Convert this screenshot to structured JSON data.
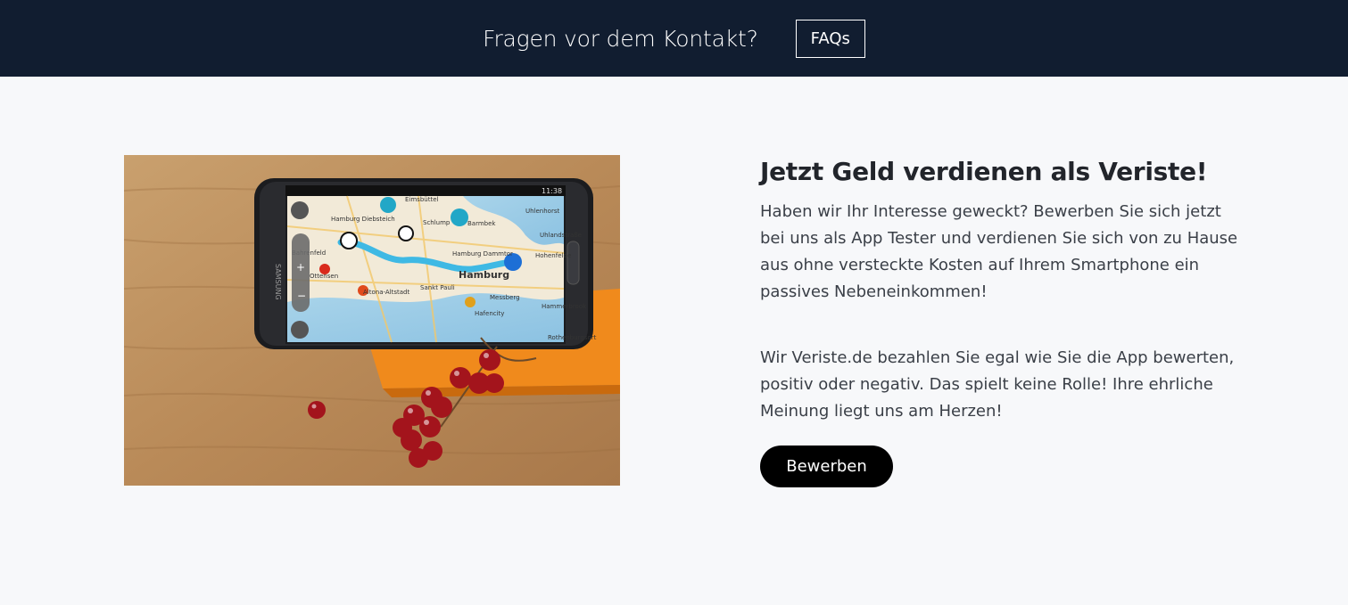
{
  "header": {
    "question": "Fragen vor dem Kontakt?",
    "faq_label": "FAQs"
  },
  "promo": {
    "heading": "Jetzt Geld verdienen als Veriste!",
    "paragraph_1": "Haben wir Ihr Interesse geweckt? Bewerben Sie sich jetzt bei uns als App Tester und verdienen Sie sich von zu Hause aus ohne versteckte Kosten auf Ihrem Smartphone ein passives Nebeneinkommen!",
    "paragraph_2": "Wir Veriste.de bezahlen Sie egal wie Sie die App bewerten, positiv oder negativ. Das spielt keine Rolle! Ihre ehrliche Meinung liegt uns am Herzen!",
    "apply_label": "Bewerben"
  },
  "photo": {
    "phone_brand": "SAMSUNG",
    "status_time": "11:38",
    "map_labels": [
      "Hamburg Diebsteich",
      "Schlump",
      "Barmbek",
      "Hamburg Dammtor",
      "Uhlenhorst",
      "Hamburg",
      "Altona-Altstadt",
      "Ottensen",
      "Sankt Pauli",
      "Messberg",
      "Hafencity",
      "Hohenfelde",
      "Hammerbrook",
      "Rothenburgsort",
      "Eimsbüttel",
      "Bahrenfeld",
      "Uhlandstraße"
    ]
  },
  "colors": {
    "topbar_bg": "#111d30",
    "page_bg": "#f7f8fa",
    "button_bg": "#000000",
    "route_blue": "#3fb9e4"
  }
}
